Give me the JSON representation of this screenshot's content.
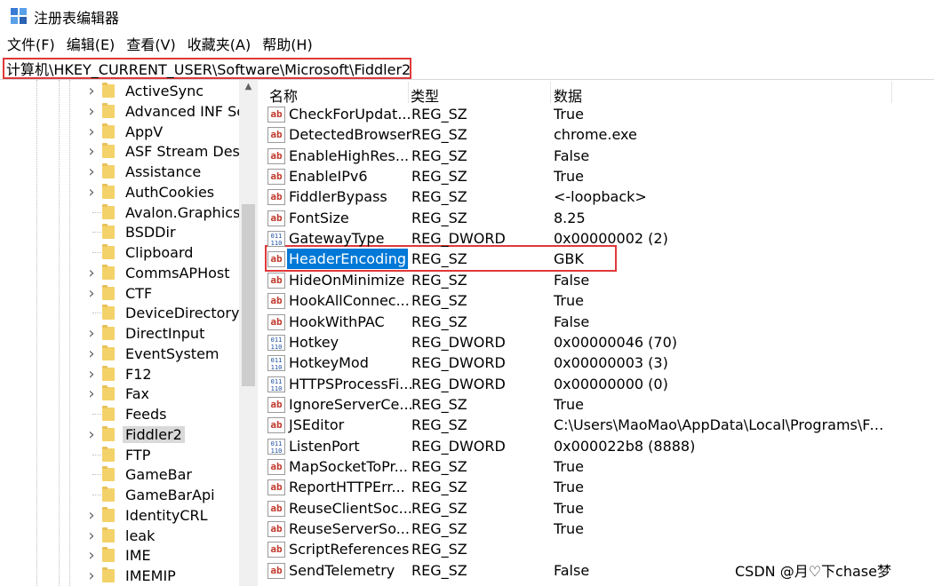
{
  "window": {
    "title": "注册表编辑器",
    "icon": "registry-editor-icon"
  },
  "menu": [
    "文件(F)",
    "编辑(E)",
    "查看(V)",
    "收藏夹(A)",
    "帮助(H)"
  ],
  "address": "计算机\\HKEY_CURRENT_USER\\Software\\Microsoft\\Fiddler2",
  "tree": {
    "items": [
      {
        "label": "ActiveSync",
        "expandable": true
      },
      {
        "label": "Advanced INF Se",
        "expandable": true
      },
      {
        "label": "AppV",
        "expandable": true
      },
      {
        "label": "ASF Stream Desc",
        "expandable": true
      },
      {
        "label": "Assistance",
        "expandable": true
      },
      {
        "label": "AuthCookies",
        "expandable": true
      },
      {
        "label": "Avalon.Graphics",
        "expandable": false
      },
      {
        "label": "BSDDir",
        "expandable": false
      },
      {
        "label": "Clipboard",
        "expandable": false
      },
      {
        "label": "CommsAPHost",
        "expandable": true
      },
      {
        "label": "CTF",
        "expandable": true
      },
      {
        "label": "DeviceDirectory",
        "expandable": false
      },
      {
        "label": "DirectInput",
        "expandable": true
      },
      {
        "label": "EventSystem",
        "expandable": true
      },
      {
        "label": "F12",
        "expandable": true
      },
      {
        "label": "Fax",
        "expandable": true
      },
      {
        "label": "Feeds",
        "expandable": false
      },
      {
        "label": "Fiddler2",
        "expandable": true,
        "selected": true
      },
      {
        "label": "FTP",
        "expandable": false
      },
      {
        "label": "GameBar",
        "expandable": false
      },
      {
        "label": "GameBarApi",
        "expandable": false
      },
      {
        "label": "IdentityCRL",
        "expandable": true
      },
      {
        "label": "leak",
        "expandable": true
      },
      {
        "label": "IME",
        "expandable": true
      },
      {
        "label": "IMEMIP",
        "expandable": true
      }
    ]
  },
  "list": {
    "headers": {
      "name": "名称",
      "type": "类型",
      "data": "数据"
    },
    "rows": [
      {
        "name": "CheckForUpdat...",
        "type": "REG_SZ",
        "data": "True",
        "icon": "sz"
      },
      {
        "name": "DetectedBrowser",
        "type": "REG_SZ",
        "data": "chrome.exe",
        "icon": "sz"
      },
      {
        "name": "EnableHighRes...",
        "type": "REG_SZ",
        "data": "False",
        "icon": "sz"
      },
      {
        "name": "EnableIPv6",
        "type": "REG_SZ",
        "data": "True",
        "icon": "sz"
      },
      {
        "name": "FiddlerBypass",
        "type": "REG_SZ",
        "data": "<-loopback>",
        "icon": "sz"
      },
      {
        "name": "FontSize",
        "type": "REG_SZ",
        "data": "8.25",
        "icon": "sz"
      },
      {
        "name": "GatewayType",
        "type": "REG_DWORD",
        "data": "0x00000002 (2)",
        "icon": "dw"
      },
      {
        "name": "HeaderEncoding",
        "type": "REG_SZ",
        "data": "GBK",
        "icon": "sz",
        "selected": true
      },
      {
        "name": "HideOnMinimize",
        "type": "REG_SZ",
        "data": "False",
        "icon": "sz"
      },
      {
        "name": "HookAllConnec...",
        "type": "REG_SZ",
        "data": "True",
        "icon": "sz"
      },
      {
        "name": "HookWithPAC",
        "type": "REG_SZ",
        "data": "False",
        "icon": "sz"
      },
      {
        "name": "Hotkey",
        "type": "REG_DWORD",
        "data": "0x00000046 (70)",
        "icon": "dw"
      },
      {
        "name": "HotkeyMod",
        "type": "REG_DWORD",
        "data": "0x00000003 (3)",
        "icon": "dw"
      },
      {
        "name": "HTTPSProcessFi...",
        "type": "REG_DWORD",
        "data": "0x00000000 (0)",
        "icon": "dw"
      },
      {
        "name": "IgnoreServerCe...",
        "type": "REG_SZ",
        "data": "True",
        "icon": "sz"
      },
      {
        "name": "JSEditor",
        "type": "REG_SZ",
        "data": "C:\\Users\\MaoMao\\AppData\\Local\\Programs\\Fi...",
        "icon": "sz"
      },
      {
        "name": "ListenPort",
        "type": "REG_DWORD",
        "data": "0x000022b8 (8888)",
        "icon": "dw"
      },
      {
        "name": "MapSocketToPr...",
        "type": "REG_SZ",
        "data": "True",
        "icon": "sz"
      },
      {
        "name": "ReportHTTPErr...",
        "type": "REG_SZ",
        "data": "True",
        "icon": "sz"
      },
      {
        "name": "ReuseClientSoc...",
        "type": "REG_SZ",
        "data": "True",
        "icon": "sz"
      },
      {
        "name": "ReuseServerSo...",
        "type": "REG_SZ",
        "data": "True",
        "icon": "sz"
      },
      {
        "name": "ScriptReferences",
        "type": "REG_SZ",
        "data": "",
        "icon": "sz"
      },
      {
        "name": "SendTelemetry",
        "type": "REG_SZ",
        "data": "False",
        "icon": "sz"
      }
    ]
  },
  "icons": {
    "sz_glyph": "ab",
    "dword_glyph": "011\n110"
  },
  "watermark": "CSDN @月♡下​chase梦",
  "colors": {
    "selection": "#0078d7",
    "annotation": "#e0383a",
    "folder": "#f4d26a"
  }
}
